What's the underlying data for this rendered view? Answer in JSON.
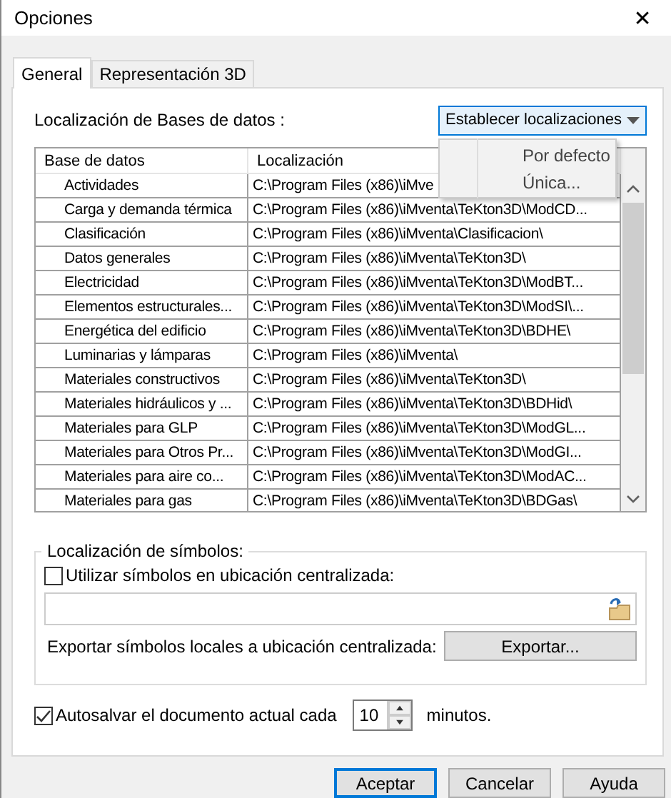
{
  "window": {
    "title": "Opciones",
    "close": "✕"
  },
  "tabs": [
    {
      "label": "General",
      "selected": true
    },
    {
      "label": "Representación 3D",
      "selected": false
    }
  ],
  "databases": {
    "label": "Localización de Bases de datos :",
    "set_button": "Establecer localizaciones",
    "menu": {
      "open": true,
      "items": [
        "Por defecto",
        "Única..."
      ]
    },
    "columns": [
      "Base de datos",
      "Localización"
    ],
    "rows": [
      {
        "name": "Actividades",
        "location": "C:\\Program Files (x86)\\iMve"
      },
      {
        "name": "Carga y demanda térmica",
        "location": "C:\\Program Files (x86)\\iMventa\\TeKton3D\\ModCD..."
      },
      {
        "name": "Clasificación",
        "location": "C:\\Program Files (x86)\\iMventa\\Clasificacion\\"
      },
      {
        "name": "Datos generales",
        "location": "C:\\Program Files (x86)\\iMventa\\TeKton3D\\"
      },
      {
        "name": "Electricidad",
        "location": "C:\\Program Files (x86)\\iMventa\\TeKton3D\\ModBT..."
      },
      {
        "name": "Elementos estructurales...",
        "location": "C:\\Program Files (x86)\\iMventa\\TeKton3D\\ModSI\\..."
      },
      {
        "name": "Energética del edificio",
        "location": "C:\\Program Files (x86)\\iMventa\\TeKton3D\\BDHE\\"
      },
      {
        "name": "Luminarias y lámparas",
        "location": "C:\\Program Files (x86)\\iMventa\\"
      },
      {
        "name": "Materiales constructivos",
        "location": "C:\\Program Files (x86)\\iMventa\\TeKton3D\\"
      },
      {
        "name": "Materiales hidráulicos y ...",
        "location": "C:\\Program Files (x86)\\iMventa\\TeKton3D\\BDHid\\"
      },
      {
        "name": "Materiales para GLP",
        "location": "C:\\Program Files (x86)\\iMventa\\TeKton3D\\ModGL..."
      },
      {
        "name": "Materiales para Otros Pr...",
        "location": "C:\\Program Files (x86)\\iMventa\\TeKton3D\\ModGI..."
      },
      {
        "name": "Materiales para aire co...",
        "location": "C:\\Program Files (x86)\\iMventa\\TeKton3D\\ModAC..."
      },
      {
        "name": "Materiales para gas",
        "location": "C:\\Program Files (x86)\\iMventa\\TeKton3D\\BDGas\\"
      }
    ]
  },
  "symbols": {
    "legend": "Localización de símbolos:",
    "use_central": {
      "label": "Utilizar símbolos en ubicación centralizada:",
      "checked": false
    },
    "export_label": "Exportar símbolos locales a ubicación centralizada:",
    "export_button": "Exportar..."
  },
  "autosave": {
    "checked": true,
    "label": "Autosalvar el documento actual cada",
    "value": "10",
    "unit": "minutos."
  },
  "buttons": [
    {
      "label": "Aceptar",
      "default": true
    },
    {
      "label": "Cancelar",
      "default": false
    },
    {
      "label": "Ayuda",
      "default": false
    }
  ]
}
